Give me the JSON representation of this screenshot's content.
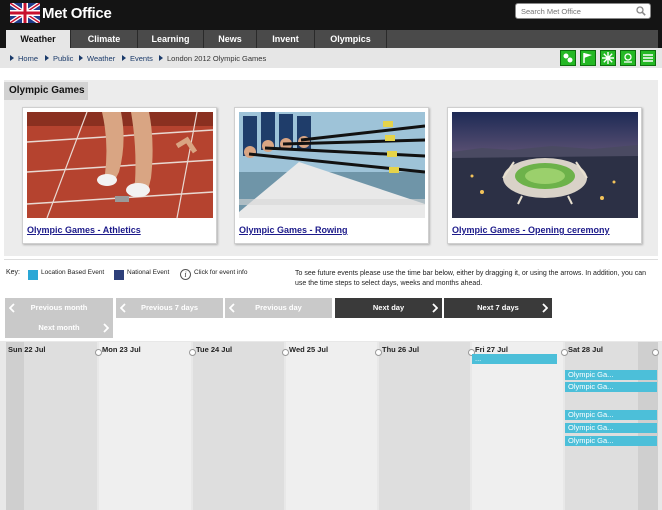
{
  "header": {
    "logo_text": "Met Office",
    "search_placeholder": "Search Met Office"
  },
  "nav": {
    "tabs": [
      "Weather",
      "Climate",
      "Learning",
      "News",
      "Invent",
      "Olympics"
    ]
  },
  "breadcrumb": [
    "Home",
    "Public",
    "Weather",
    "Events",
    "London 2012 Olympic Games"
  ],
  "section": {
    "title": "Olympic Games",
    "cards": [
      {
        "label": "Olympic Games - Athletics"
      },
      {
        "label": "Olympic Games - Rowing"
      },
      {
        "label": "Olympic Games - Opening ceremony"
      }
    ]
  },
  "key": {
    "label": "Key:",
    "location_event": "Location Based Event",
    "national_event": "National Event",
    "info": "Click for event info",
    "info_icon": "i"
  },
  "info_text": "To see future events please use the time bar below, either by dragging it, or using the arrows. In addition, you can use the time steps to select days, weeks and months ahead.",
  "buttons": {
    "previous_month": "Previous month",
    "previous_7_days": "Previous 7 days",
    "previous_day": "Previous day",
    "next_day": "Next day",
    "next_7_days": "Next 7 days",
    "next_month": "Next month"
  },
  "timeline": {
    "days": [
      "Sun 22 Jul",
      "Mon 23 Jul",
      "Tue 24 Jul",
      "Wed 25 Jul",
      "Thu 26 Jul",
      "Fri 27 Jul",
      "Sat 28 Jul"
    ],
    "fri_event": "...",
    "sat_events": [
      "Olympic Ga...",
      "Olympic Ga...",
      "Olympic Ga...",
      "Olympic Ga...",
      "Olympic Ga..."
    ]
  },
  "colors": {
    "location_event": "#2aa7d6",
    "national_event": "#2d3f7a",
    "event_bar": "#4cbfd9",
    "tool_green": "#25b825"
  }
}
